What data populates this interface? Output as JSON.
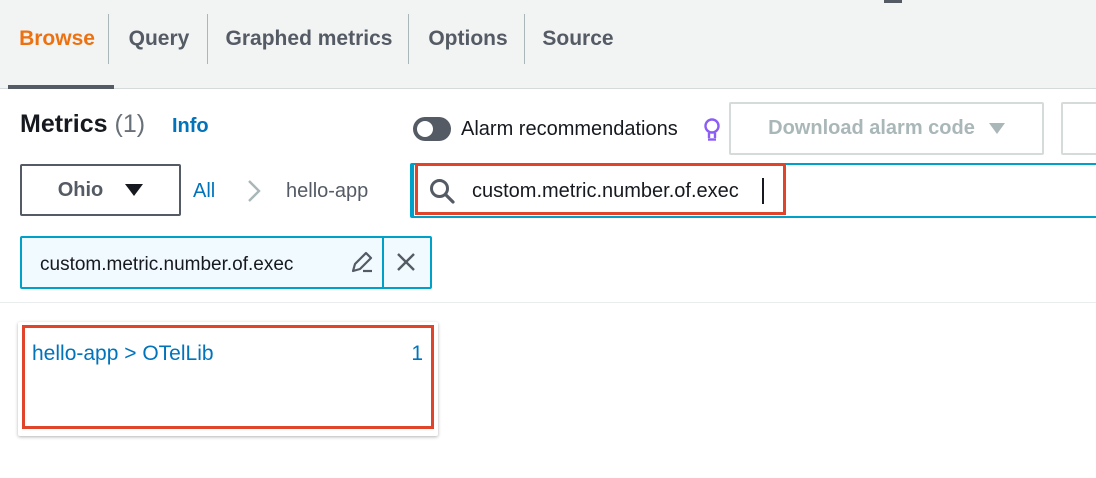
{
  "tabs": [
    {
      "label": "Browse",
      "active": true
    },
    {
      "label": "Query",
      "active": false
    },
    {
      "label": "Graphed metrics",
      "active": false
    },
    {
      "label": "Options",
      "active": false
    },
    {
      "label": "Source",
      "active": false
    }
  ],
  "header": {
    "title": "Metrics",
    "count": "(1)",
    "info_link": "Info",
    "alarm_toggle_label": "Alarm recommendations",
    "alarm_toggle_on": false,
    "download_button": "Download alarm code"
  },
  "region": {
    "selected": "Ohio"
  },
  "breadcrumb": {
    "root": "All",
    "current": "hello-app"
  },
  "search": {
    "value": "custom.metric.number.of.exec",
    "icon": "search-icon"
  },
  "filter_token": {
    "text": "custom.metric.number.of.exec"
  },
  "results": [
    {
      "label": "hello-app > OTelLib",
      "count": "1"
    }
  ],
  "colors": {
    "accent": "#ec7211",
    "link": "#0073bb",
    "focus": "#00a1c9",
    "highlight": "#e0452b",
    "bulb": "#8b5cf6"
  }
}
